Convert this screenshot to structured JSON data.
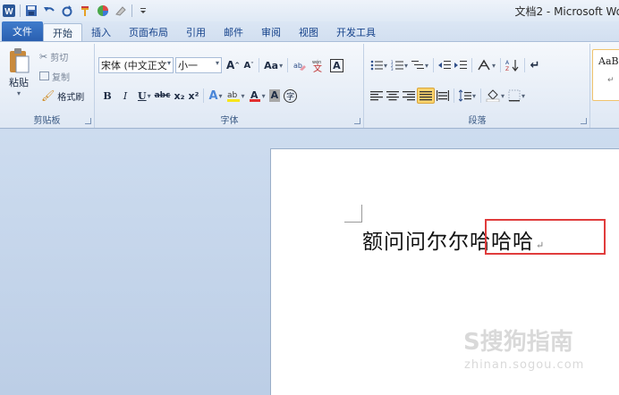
{
  "window": {
    "title": "文档2 - Microsoft Wo"
  },
  "quick_access": [
    {
      "icon": "word-logo-icon"
    },
    {
      "icon": "save-icon"
    },
    {
      "icon": "undo-icon"
    },
    {
      "icon": "redo-icon"
    },
    {
      "icon": "format-painter-icon"
    },
    {
      "icon": "color-circle-icon"
    },
    {
      "icon": "eraser-icon"
    },
    {
      "icon": "customize-menu-icon"
    }
  ],
  "tabs": [
    {
      "label": "文件",
      "kind": "file"
    },
    {
      "label": "开始",
      "kind": "active"
    },
    {
      "label": "插入"
    },
    {
      "label": "页面布局"
    },
    {
      "label": "引用"
    },
    {
      "label": "邮件"
    },
    {
      "label": "审阅"
    },
    {
      "label": "视图"
    },
    {
      "label": "开发工具"
    }
  ],
  "ribbon": {
    "clipboard": {
      "label": "剪贴板",
      "paste": "粘贴",
      "cut": "剪切",
      "copy": "复制",
      "format_painter": "格式刷"
    },
    "font": {
      "label": "字体",
      "font_name": "宋体 (中文正文",
      "font_size": "小一",
      "grow": "A",
      "shrink": "A",
      "change_case": "Aa",
      "bold": "B",
      "italic": "I",
      "underline": "U",
      "strike": "abc",
      "subscript": "x₂",
      "superscript": "x²",
      "text_effect": "A",
      "font_color": "A",
      "char_shading": "A",
      "enclose": "字",
      "phonetic": "wén",
      "char_border": "A"
    },
    "paragraph": {
      "label": "段落"
    },
    "styles": {
      "preview": "AaB"
    }
  },
  "document": {
    "text_before": "额问问尔尔",
    "text_selected": "哈哈哈",
    "paragraph_mark": "↵"
  },
  "watermark": {
    "text": "S搜狗指南",
    "sub": "zhinan.sogou.com"
  },
  "colors": {
    "file_tab": "#2a5fb0",
    "highlight_border": "#e03c3c",
    "font_color_bar": "#e23030",
    "highlight_color_bar": "#f7e51c"
  }
}
